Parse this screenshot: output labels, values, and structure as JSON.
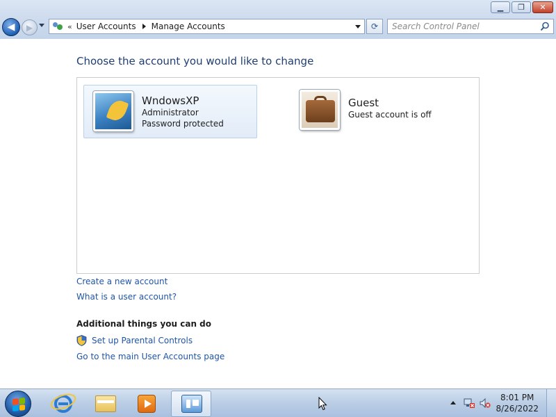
{
  "window": {
    "controls": {
      "minimize": "▁",
      "maximize": "❐",
      "close": "✕"
    }
  },
  "nav": {
    "back_glyph": "◀",
    "forward_glyph": "▶",
    "breadcrumb_overflow": "«",
    "breadcrumb": [
      "User Accounts",
      "Manage Accounts"
    ],
    "refresh_glyph": "⟳",
    "search_placeholder": "Search Control Panel"
  },
  "main": {
    "title": "Choose the account you would like to change",
    "accounts": [
      {
        "name": "WndowsXP",
        "lines": [
          "Administrator",
          "Password protected"
        ],
        "icon": "leaf-avatar-icon"
      },
      {
        "name": "Guest",
        "lines": [
          "Guest account is off"
        ],
        "icon": "suitcase-avatar-icon"
      }
    ],
    "links": {
      "create_account": "Create a new account",
      "what_is": "What is a user account?"
    },
    "additional": {
      "title": "Additional things you can do",
      "parental_controls": "Set up Parental Controls",
      "main_page": "Go to the main User Accounts page"
    }
  },
  "taskbar": {
    "pinned": [
      "internet-explorer-icon",
      "windows-explorer-icon",
      "media-player-icon",
      "control-panel-icon"
    ],
    "active": "control-panel-icon",
    "clock": {
      "time": "8:01 PM",
      "date": "8/26/2022"
    }
  },
  "colors": {
    "link": "#1e55a8",
    "title": "#1e3d73",
    "chrome": "#cfdcee",
    "taskbar": "#bccfe6"
  }
}
